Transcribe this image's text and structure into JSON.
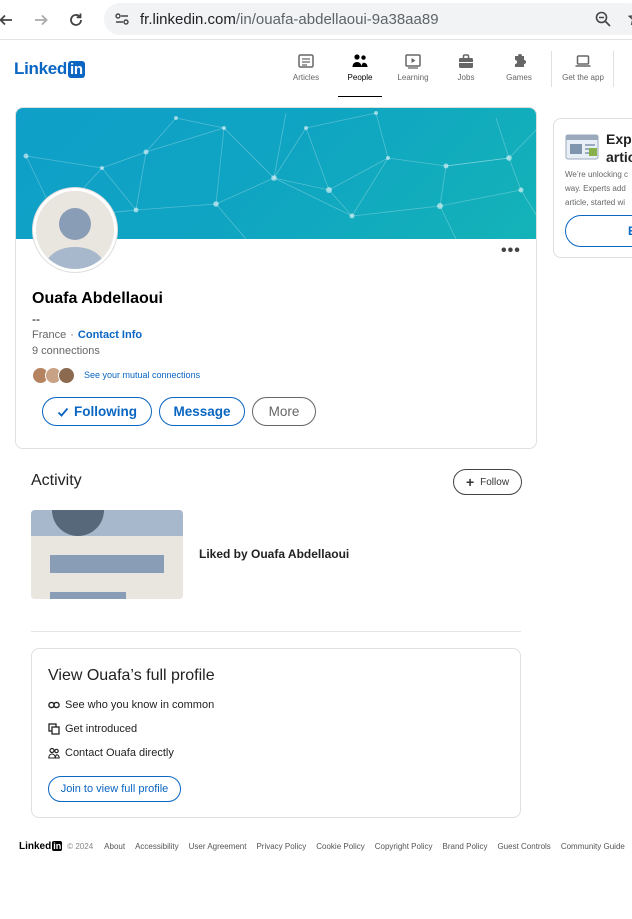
{
  "browser": {
    "url_host": "fr.linkedin.com",
    "url_path": "/in/ouafa-abdellaoui-9a38aa89"
  },
  "header": {
    "logo_text": "Linked",
    "logo_in": "in",
    "nav": [
      {
        "label": "Articles",
        "icon": "articles-icon"
      },
      {
        "label": "People",
        "icon": "people-icon",
        "active": true
      },
      {
        "label": "Learning",
        "icon": "learning-icon"
      },
      {
        "label": "Jobs",
        "icon": "jobs-icon"
      },
      {
        "label": "Games",
        "icon": "games-icon"
      },
      {
        "label": "Get the app",
        "icon": "laptop-icon"
      }
    ]
  },
  "profile": {
    "name": "Ouafa Abdellaoui",
    "headline": "--",
    "location": "France",
    "contact_info": "Contact Info",
    "connections": "9 connections",
    "mutual_link": "See your mutual connections",
    "buttons": {
      "following": "Following",
      "message": "Message",
      "more": "More"
    }
  },
  "activity": {
    "title": "Activity",
    "follow_label": "Follow",
    "item_text": "Liked by Ouafa Abdellaoui"
  },
  "full_profile": {
    "title": "View Ouafa’s full profile",
    "items": [
      "See who you know in common",
      "Get introduced",
      "Contact Ouafa directly"
    ],
    "join_label": "Join to view full profile"
  },
  "rail": {
    "title_line1": "Explo",
    "title_line2": "artic",
    "text_line1": "We’re unlocking c",
    "text_line2": "way. Experts add",
    "text_line3": "article, started wi",
    "button_label": "E"
  },
  "footer": {
    "logo_text": "Linked",
    "logo_in": "in",
    "copyright": "© 2024",
    "links": [
      "About",
      "Accessibility",
      "User Agreement",
      "Privacy Policy",
      "Cookie Policy",
      "Copyright Policy",
      "Brand Policy",
      "Guest Controls",
      "Community Guide"
    ]
  },
  "colors": {
    "brand": "#0a66c2",
    "cover_start": "#0f9fc9",
    "cover_end": "#14b3b8"
  }
}
